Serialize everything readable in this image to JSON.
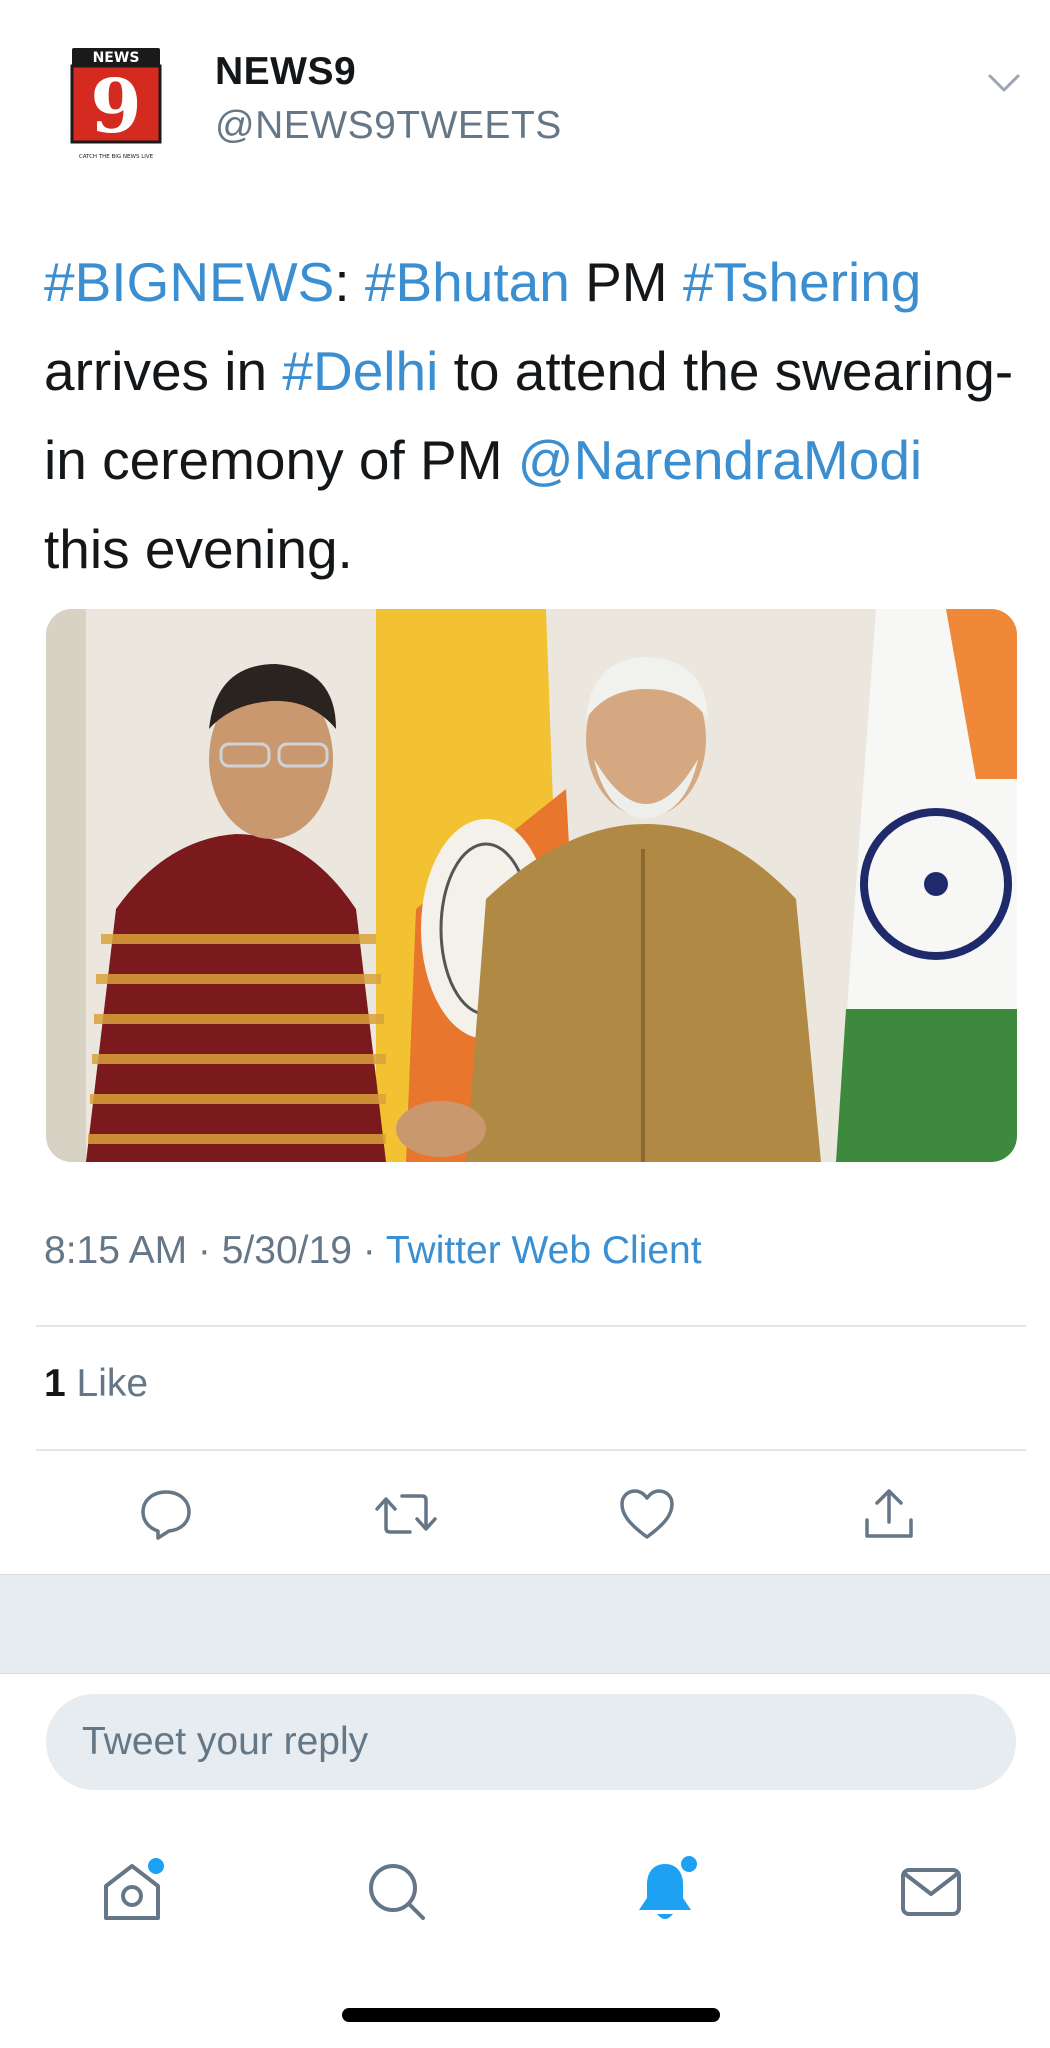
{
  "tweet": {
    "author": {
      "name": "NEWS9",
      "handle": "@NEWS9TWEETS",
      "avatar": {
        "brand_top": "NEWS",
        "brand_digit": "9",
        "tagline": "CATCH THE BIG NEWS LIVE",
        "color": "#d42a20"
      }
    },
    "text_parts": {
      "p1": "#BIGNEWS",
      "p2": ": ",
      "p3": "#Bhutan",
      "p4": " PM ",
      "p5": "#Tshering",
      "p6": " arrives in ",
      "p7": "#Delhi",
      "p8": " to attend the swearing-in ceremony of PM ",
      "p9": "@NarendraModi",
      "p10": " this evening."
    },
    "time": "8:15 AM",
    "date": "5/30/19",
    "separator": " · ",
    "client": "Twitter Web Client",
    "likes_count": "1",
    "likes_label": "Like"
  },
  "actions": [
    {
      "icon": "reply-icon"
    },
    {
      "icon": "retweet-icon"
    },
    {
      "icon": "like-heart-icon"
    },
    {
      "icon": "share-icon"
    }
  ],
  "reply": {
    "placeholder": "Tweet your reply"
  },
  "tabbar": {
    "items": [
      {
        "icon": "home-icon",
        "has_dot": true
      },
      {
        "icon": "search-icon",
        "has_dot": false
      },
      {
        "icon": "notifications-bell-icon",
        "has_dot": true,
        "active": true
      },
      {
        "icon": "messages-mail-icon",
        "has_dot": false
      }
    ]
  },
  "colors": {
    "link": "#3b8ed0",
    "secondary_text": "#657786",
    "primary_text": "#14171a",
    "accent": "#1da1f2",
    "band": "#e6ecf0"
  }
}
